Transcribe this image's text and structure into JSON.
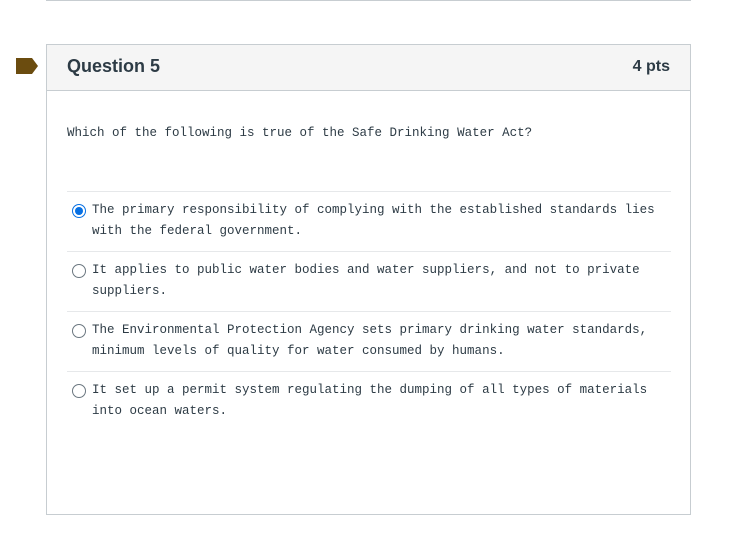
{
  "question": {
    "title": "Question 5",
    "points": "4 pts",
    "text": "Which of the following is true of the Safe Drinking Water Act?",
    "flag_icon": "flag-icon",
    "flag_color": "#6b4c0f",
    "accent_color": "#0770e3",
    "answers": [
      {
        "label": "The primary responsibility of complying with the established standards lies with the federal government.",
        "selected": true
      },
      {
        "label": "It applies to public water bodies and water suppliers, and not to private suppliers.",
        "selected": false
      },
      {
        "label": "The Environmental Protection Agency sets primary drinking water standards, minimum levels of quality for water consumed by humans.",
        "selected": false
      },
      {
        "label": "It set up a permit system regulating the dumping of all types of materials into ocean waters.",
        "selected": false
      }
    ]
  }
}
